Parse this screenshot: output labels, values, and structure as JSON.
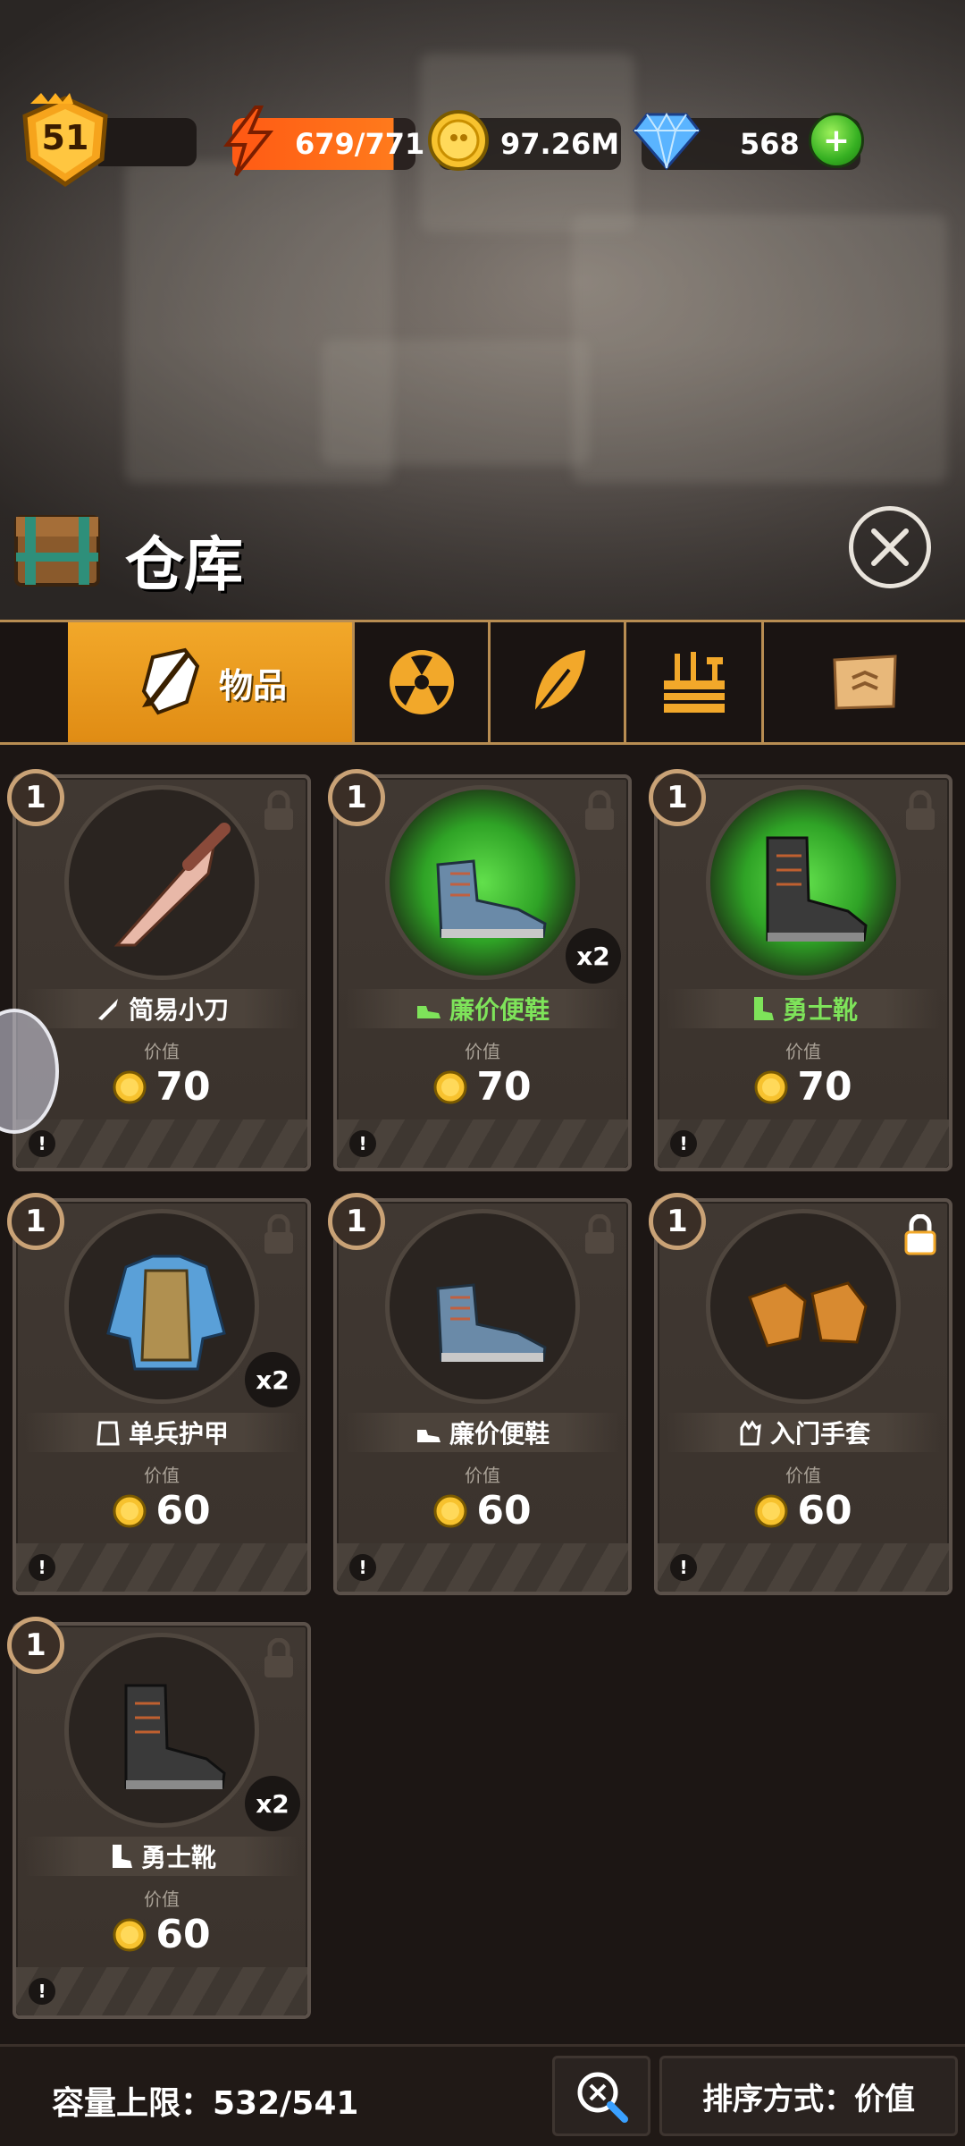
{
  "hud": {
    "level": "51",
    "energy": "679/771",
    "coins": "97.26M",
    "gems": "568",
    "add_label": "+"
  },
  "title": "仓库",
  "tabs": [
    {
      "label": "物品",
      "icon": "shield-sword-icon",
      "active": true
    },
    {
      "label": "",
      "icon": "radiation-icon",
      "active": false
    },
    {
      "label": "",
      "icon": "leaf-icon",
      "active": false
    },
    {
      "label": "",
      "icon": "toolbox-icon",
      "active": false
    },
    {
      "label": "",
      "icon": "map-scroll-icon",
      "active": false
    }
  ],
  "items": [
    {
      "rank": "1",
      "name": "简易小刀",
      "value_label": "价值",
      "value": "70",
      "count": "",
      "rarity": "common",
      "locked": false,
      "icon": "knife-icon"
    },
    {
      "rank": "1",
      "name": "廉价便鞋",
      "value_label": "价值",
      "value": "70",
      "count": "x2",
      "rarity": "uncommon",
      "locked": false,
      "icon": "sneaker-icon"
    },
    {
      "rank": "1",
      "name": "勇士靴",
      "value_label": "价值",
      "value": "70",
      "count": "",
      "rarity": "uncommon",
      "locked": false,
      "icon": "boot-icon"
    },
    {
      "rank": "1",
      "name": "单兵护甲",
      "value_label": "价值",
      "value": "60",
      "count": "x2",
      "rarity": "common",
      "locked": false,
      "icon": "vest-icon"
    },
    {
      "rank": "1",
      "name": "廉价便鞋",
      "value_label": "价值",
      "value": "60",
      "count": "",
      "rarity": "common",
      "locked": false,
      "icon": "sneaker-icon"
    },
    {
      "rank": "1",
      "name": "入门手套",
      "value_label": "价值",
      "value": "60",
      "count": "",
      "rarity": "common",
      "locked": true,
      "icon": "gloves-icon"
    },
    {
      "rank": "1",
      "name": "勇士靴",
      "value_label": "价值",
      "value": "60",
      "count": "x2",
      "rarity": "common",
      "locked": false,
      "icon": "boot-icon"
    }
  ],
  "footer": {
    "capacity": "容量上限：532/541",
    "sort": "排序方式：价值"
  },
  "colors": {
    "accent": "#f2a82a",
    "uncommon_text": "#7ee35a",
    "energy": "#ff5a14"
  }
}
